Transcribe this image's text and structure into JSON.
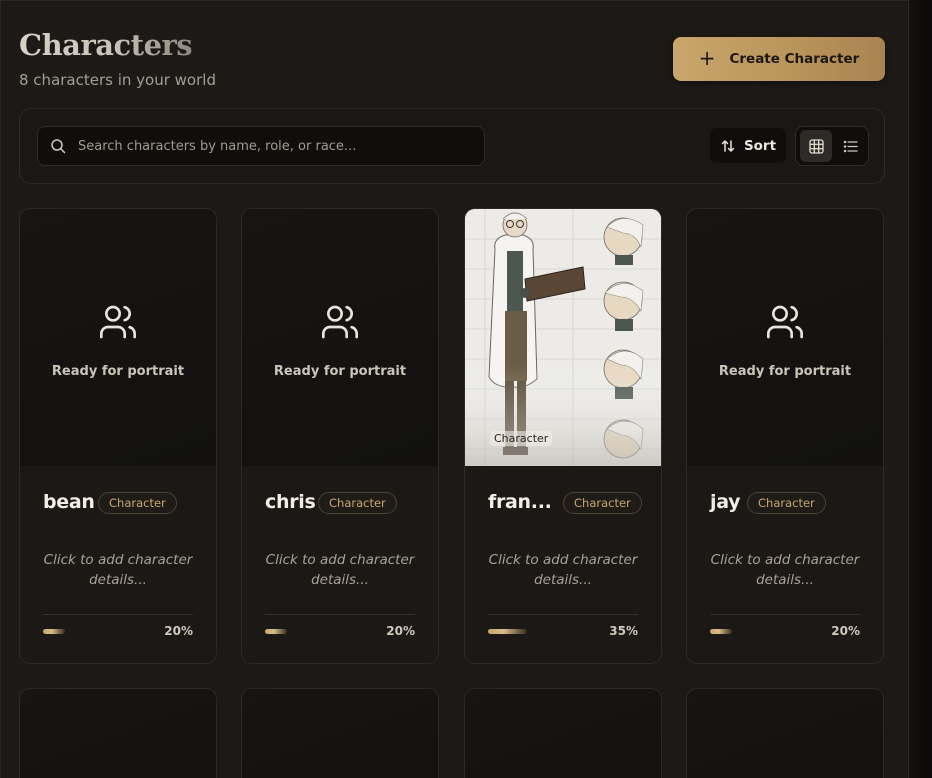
{
  "header": {
    "title": "Characters",
    "subtitle": "8 characters in your world",
    "create_button_label": "Create Character"
  },
  "toolbar": {
    "search_placeholder": "Search characters by name, role, or race...",
    "sort_label": "Sort",
    "view_mode": "grid"
  },
  "colors": {
    "accent": "#c9a66b",
    "background": "#1c1917",
    "card": "#1b1816"
  },
  "cards": [
    {
      "name": "bean",
      "role": "Character",
      "has_portrait": false,
      "portrait_placeholder": "Ready for portrait",
      "description": "Click to add character details...",
      "completion_label": "20%",
      "completion": 0.2
    },
    {
      "name": "chris",
      "role": "Character",
      "has_portrait": false,
      "portrait_placeholder": "Ready for portrait",
      "description": "Click to add character details...",
      "completion_label": "20%",
      "completion": 0.2
    },
    {
      "name": "fran...",
      "role": "Character",
      "has_portrait": true,
      "portrait_tag": "Character",
      "description": "Click to add character details...",
      "completion_label": "35%",
      "completion": 0.35
    },
    {
      "name": "jay",
      "role": "Character",
      "has_portrait": false,
      "portrait_placeholder": "Ready for portrait",
      "description": "Click to add character details...",
      "completion_label": "20%",
      "completion": 0.2
    }
  ]
}
